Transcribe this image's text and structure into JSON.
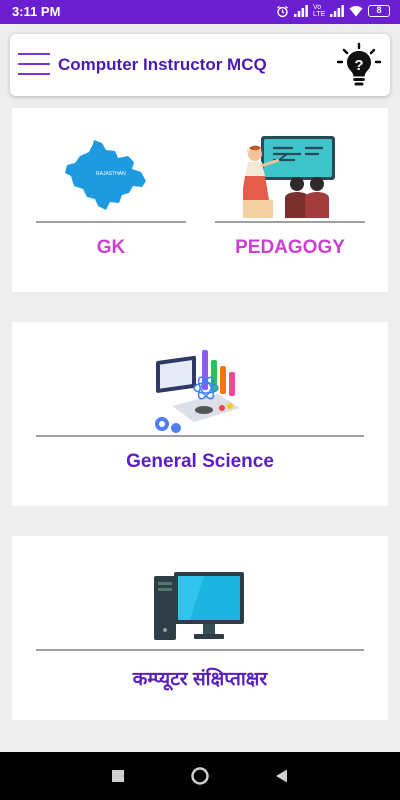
{
  "status_bar": {
    "time": "3:11 PM",
    "battery": "8",
    "network": "Vo LTE"
  },
  "app_bar": {
    "title": "Computer Instructor MCQ",
    "menu_icon": "hamburger-menu-icon",
    "action_icon": "lightbulb-idea-icon"
  },
  "cards": {
    "gk": {
      "label": "GK",
      "icon": "rajasthan-map-icon",
      "map_text": "RAJASTHAN"
    },
    "pedagogy": {
      "label": "PEDAGOGY",
      "icon": "teacher-classroom-icon"
    },
    "science": {
      "label": "General Science",
      "icon": "science-lab-icon"
    },
    "computer": {
      "label": "कम्प्यूटर संक्षिप्ताक्षर",
      "icon": "desktop-computer-icon"
    }
  },
  "colors": {
    "status_bar": "#6a1fd0",
    "title": "#4b1bb0",
    "label_purple": "#5a1fc0",
    "label_magenta": "#cc3fd4"
  },
  "nav_bar": {
    "buttons": [
      "recent-apps-icon",
      "home-icon",
      "back-icon"
    ]
  }
}
